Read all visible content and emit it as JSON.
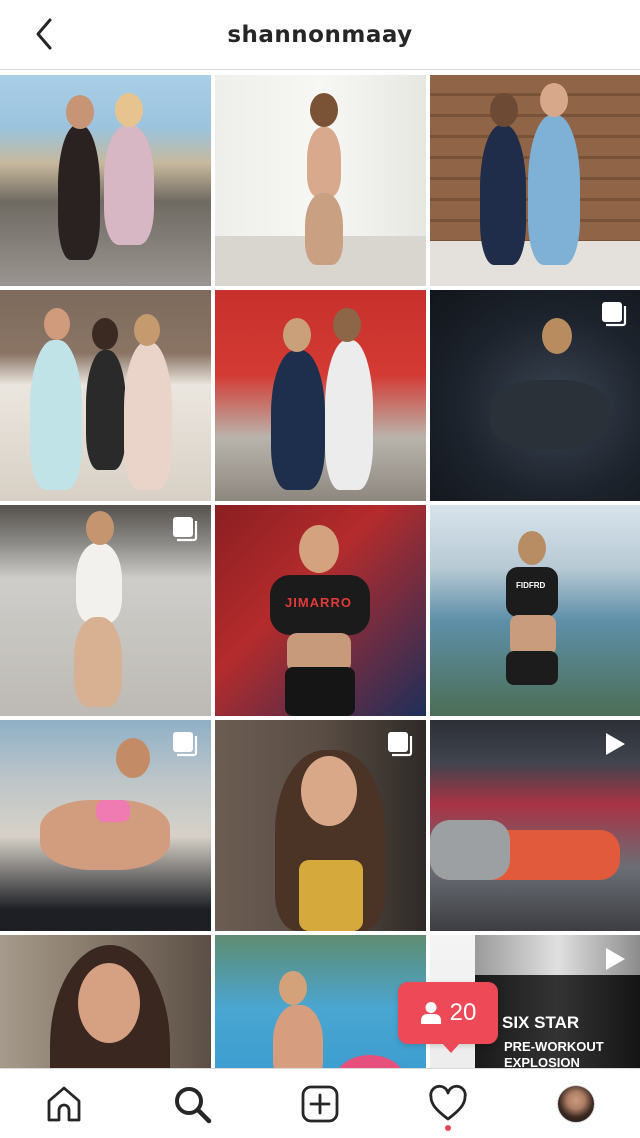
{
  "header": {
    "back_icon": "chevron-left-icon",
    "title": "shannonmaay"
  },
  "grid": {
    "tiles": [
      {
        "index": 1,
        "overlay": ""
      },
      {
        "index": 2,
        "overlay": ""
      },
      {
        "index": 3,
        "overlay": ""
      },
      {
        "index": 4,
        "overlay": ""
      },
      {
        "index": 5,
        "overlay": ""
      },
      {
        "index": 6,
        "overlay": "carousel-icon"
      },
      {
        "index": 7,
        "overlay": "carousel-icon"
      },
      {
        "index": 8,
        "overlay": ""
      },
      {
        "index": 9,
        "overlay": ""
      },
      {
        "index": 10,
        "overlay": "carousel-icon"
      },
      {
        "index": 11,
        "overlay": "carousel-icon"
      },
      {
        "index": 12,
        "overlay": "video-icon"
      },
      {
        "index": 13,
        "overlay": ""
      },
      {
        "index": 14,
        "overlay": ""
      },
      {
        "index": 15,
        "overlay": "video-icon"
      }
    ],
    "tile_texts": {
      "t8_jersey": "JIMARRO",
      "t9_top": "FIDFRD",
      "t15_brand": "SIX STAR",
      "t15_product": "PRE-WORKOUT EXPLOSION"
    }
  },
  "follower_notification": {
    "icon": "person-icon",
    "count": "20"
  },
  "bottom_nav": {
    "items": [
      {
        "name": "home",
        "icon": "home-icon"
      },
      {
        "name": "search",
        "icon": "search-icon",
        "active": true
      },
      {
        "name": "create",
        "icon": "plus-square-icon"
      },
      {
        "name": "activity",
        "icon": "heart-icon"
      },
      {
        "name": "profile",
        "icon": "avatar"
      }
    ]
  },
  "colors": {
    "badge": "#ed4956",
    "text": "#262626",
    "border": "#dbdbdb"
  }
}
